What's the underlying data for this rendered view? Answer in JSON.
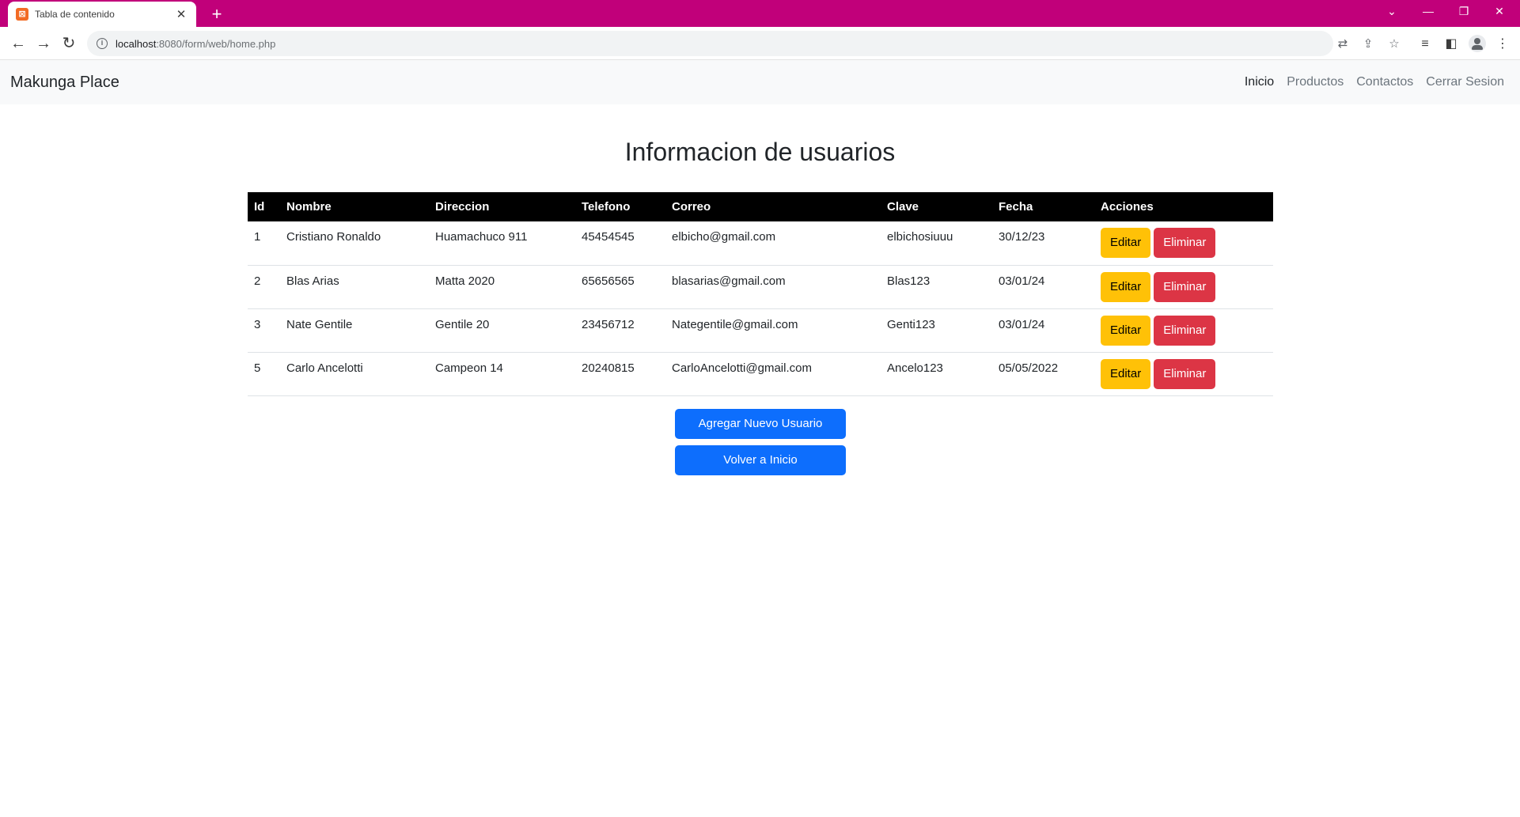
{
  "browser": {
    "tab_title": "Tabla de contenido",
    "url_host": "localhost",
    "url_rest": ":8080/form/web/home.php"
  },
  "navbar": {
    "brand": "Makunga Place",
    "links": [
      "Inicio",
      "Productos",
      "Contactos",
      "Cerrar Sesion"
    ],
    "active": "Inicio"
  },
  "main": {
    "title": "Informacion de usuarios",
    "table": {
      "headers": [
        "Id",
        "Nombre",
        "Direccion",
        "Telefono",
        "Correo",
        "Clave",
        "Fecha",
        "Acciones"
      ],
      "rows": [
        [
          "1",
          "Cristiano Ronaldo",
          "Huamachuco 911",
          "45454545",
          "elbicho@gmail.com",
          "elbichosiuuu",
          "30/12/23"
        ],
        [
          "2",
          "Blas Arias",
          "Matta 2020",
          "65656565",
          "blasarias@gmail.com",
          "Blas123",
          "03/01/24"
        ],
        [
          "3",
          "Nate Gentile",
          "Gentile 20",
          "23456712",
          "Nategentile@gmail.com",
          "Genti123",
          "03/01/24"
        ],
        [
          "5",
          "Carlo Ancelotti",
          "Campeon 14",
          "20240815",
          "CarloAncelotti@gmail.com",
          "Ancelo123",
          "05/05/2022"
        ]
      ],
      "edit_label": "Editar",
      "delete_label": "Eliminar"
    },
    "add_button": "Agregar Nuevo Usuario",
    "back_button": "Volver a Inicio"
  },
  "colors": {
    "browser_frame": "#c1007a",
    "table_header": "#000000",
    "edit_button": "#ffc107",
    "delete_button": "#dc3545",
    "primary_button": "#0d6efd"
  }
}
